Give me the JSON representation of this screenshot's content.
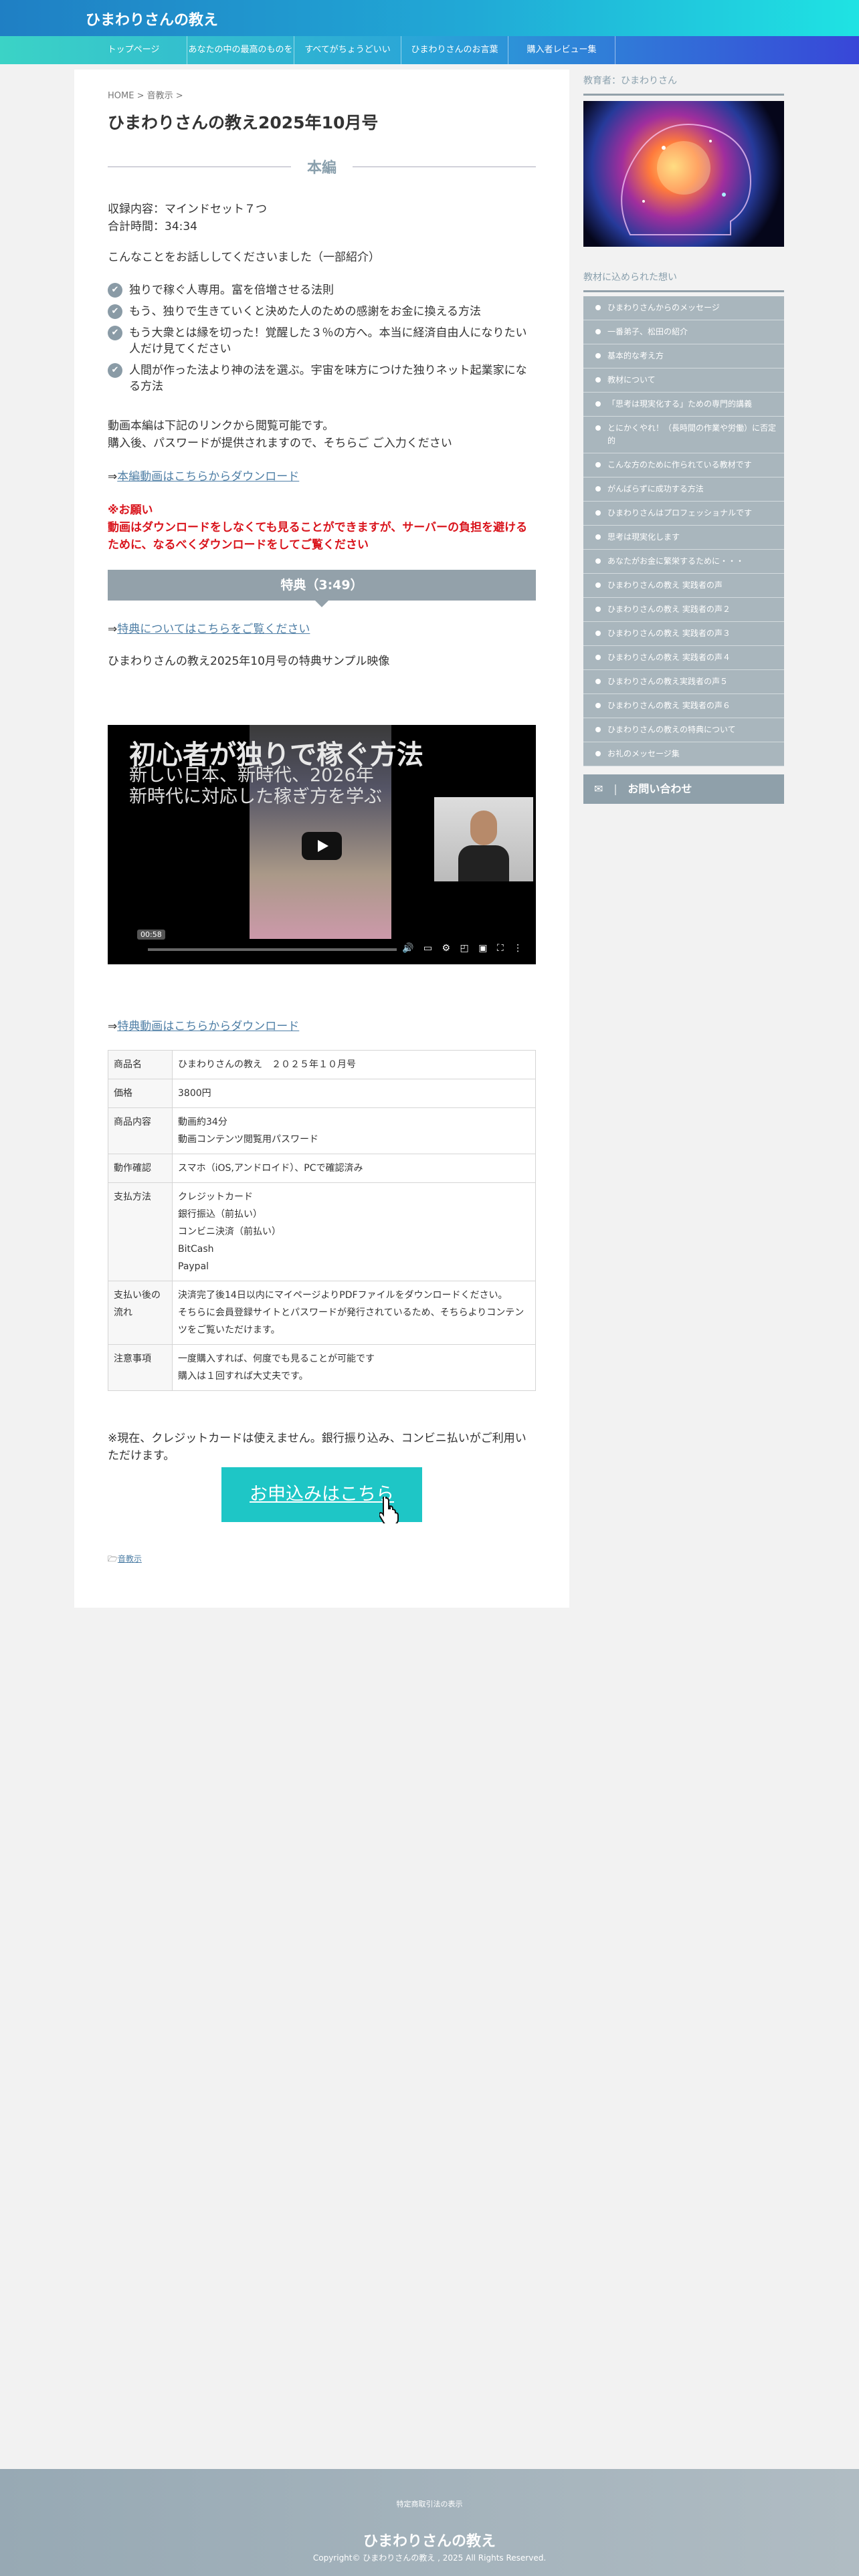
{
  "header": {
    "site_title": "ひまわりさんの教え"
  },
  "nav": [
    "トップページ",
    "あなたの中の最高のものを",
    "すべてがちょうどいい",
    "ひまわりさんのお言葉",
    "購入者レビュー集"
  ],
  "breadcrumb": {
    "home": "HOME",
    "sep1": " > ",
    "cat": "音教示",
    "sep2": " >"
  },
  "title": "ひまわりさんの教え2025年10月号",
  "section_main": "本編",
  "content": {
    "line1": "収録内容：マインドセット７つ",
    "line2": "合計時間：34:34",
    "intro": "こんなことをお話ししてくださいました（一部紹介）",
    "checks": [
      "独りで稼ぐ人専用。富を倍増させる法則",
      "もう、独りで生きていくと決めた人のための感謝をお金に換える方法",
      "もう大衆とは縁を切った！覚醒した３％の方へ。本当に経済自由人になりたい人だけ見てください",
      "人間が作った法より神の法を選ぶ。宇宙を味方につけた独りネット起業家になる方法"
    ],
    "check_icon": "✔",
    "notice1": "動画本編は下記のリンクから閲覧可能です。",
    "notice2": "購入後、パスワードが提供されますので、そちらご ご入力ください",
    "dl_arrow": "⇒",
    "dl_link": "本編動画はこちらからダウンロード",
    "warn_title": "※お願い",
    "warn_text": "動画はダウンロードをしなくても見ることができますが、サーバーの負担を避けるために、なるべくダウンロードをしてご覧ください"
  },
  "bonus": {
    "bar": "特典（3:49）",
    "arrow": "⇒",
    "link": "特典についてはこちらをご覧ください",
    "desc": "ひまわりさんの教え2025年10月号の特典サンプル映像",
    "video_title": "初心者が独りで稼ぐ方法",
    "video_sub1": "新しい日本、新時代、2026年",
    "video_sub2": "新時代に対応した稼ぎ方を学ぶ",
    "video_time": "00:58",
    "video_controls": "🔊 ▭ ⚙ ◰ ▣ ⛶ ⋮",
    "dl_arrow": "⇒",
    "dl_link": "特典動画はこちらからダウンロード"
  },
  "spec": [
    {
      "k": "商品名",
      "v": [
        "ひまわりさんの教え　２０２５年１０月号"
      ]
    },
    {
      "k": "価格",
      "v": [
        "3800円"
      ]
    },
    {
      "k": "商品内容",
      "v": [
        "動画約34分",
        "動画コンテンツ閲覧用パスワード"
      ]
    },
    {
      "k": "動作確認",
      "v": [
        "スマホ（iOS,アンドロイド）、PCで確認済み"
      ]
    },
    {
      "k": "支払方法",
      "v": [
        "クレジットカード",
        "銀行振込（前払い）",
        "コンビニ決済（前払い）",
        "BitCash",
        "Paypal"
      ]
    },
    {
      "k": "支払い後の流れ",
      "v": [
        "決済完了後14日以内にマイページよりPDFファイルをダウンロードください。",
        "そちらに会員登録サイトとパスワードが発行されているため、そちらよりコンテンツをご覧いただけます。"
      ]
    },
    {
      "k": "注意事項",
      "v": [
        "一度購入すれば、何度でも見ることが可能です",
        "購入は１回すれば大丈夫です。"
      ]
    }
  ],
  "payment_note": "※現在、クレジットカードは使えません。銀行振り込み、コンビニ払いがご利用いただけます。",
  "apply_button": "お申込みはこちら",
  "category": {
    "icon": "🗁",
    "label": "音教示"
  },
  "sidebar": {
    "author_title": "教育者：ひまわりさん",
    "menu_title": "教材に込められた想い",
    "menu": [
      "ひまわりさんからのメッセージ",
      "一番弟子、松田の紹介",
      "基本的な考え方",
      "教材について",
      "「思考は現実化する」ための専門的講義",
      "とにかくやれ！（長時間の作業や労働）に否定的",
      "こんな方のために作られている教材です",
      "がんばらずに成功する方法",
      "ひまわりさんはプロフェッショナルです",
      "思考は現実化します",
      "あなたがお金に繁栄するために・・・",
      "ひまわりさんの教え 実践者の声",
      "ひまわりさんの教え 実践者の声２",
      "ひまわりさんの教え 実践者の声３",
      "ひまわりさんの教え 実践者の声４",
      "ひまわりさんの教え実践者の声５",
      "ひまわりさんの教え 実践者の声６",
      "ひまわりさんの教えの特典について",
      "お礼のメッセージ集"
    ],
    "contact_icon": "✉",
    "contact": "お問い合わせ"
  },
  "footer": {
    "link": "特定商取引法の表示",
    "title": "ひまわりさんの教え",
    "copyright": "Copyright© ひまわりさんの教え , 2025 All Rights Reserved."
  }
}
